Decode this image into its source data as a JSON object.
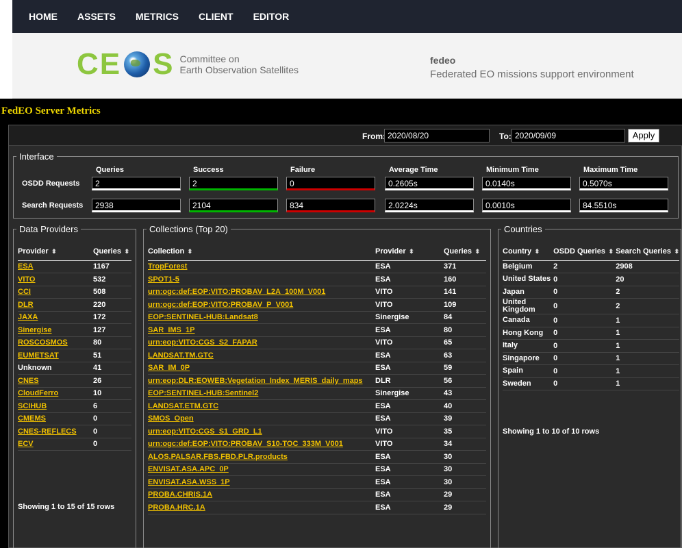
{
  "nav": [
    "HOME",
    "ASSETS",
    "METRICS",
    "CLIENT",
    "EDITOR"
  ],
  "banner": {
    "logo_text": "CEOS",
    "tagline_1": "Committee on",
    "tagline_2": "Earth Observation Satellites",
    "fedeo_name": "fedeo",
    "fedeo_desc": "Federated EO missions support environment"
  },
  "page_title": "FedEO Server Metrics",
  "dates": {
    "from_label": "From:",
    "from_value": "2020/08/20",
    "to_label": "To:",
    "to_value": "2020/09/09",
    "apply_label": "Apply"
  },
  "interface": {
    "legend": "Interface",
    "headers": [
      "Queries",
      "Success",
      "Failure",
      "Average Time",
      "Minimum Time",
      "Maximum Time"
    ],
    "rows": [
      {
        "label": "OSDD Requests",
        "values": [
          "2",
          "2",
          "0",
          "0.2605s",
          "0.0140s",
          "0.5070s"
        ]
      },
      {
        "label": "Search Requests",
        "values": [
          "2938",
          "2104",
          "834",
          "2.0224s",
          "0.0010s",
          "84.5510s"
        ]
      }
    ]
  },
  "providers": {
    "legend": "Data Providers",
    "headers": [
      "Provider",
      "Queries"
    ],
    "rows": [
      [
        "ESA",
        "1167",
        true
      ],
      [
        "VITO",
        "532",
        true
      ],
      [
        "CCI",
        "508",
        true
      ],
      [
        "DLR",
        "220",
        true
      ],
      [
        "JAXA",
        "172",
        true
      ],
      [
        "Sinergise",
        "127",
        true
      ],
      [
        "ROSCOSMOS",
        "80",
        true
      ],
      [
        "EUMETSAT",
        "51",
        true
      ],
      [
        "Unknown",
        "41",
        false
      ],
      [
        "CNES",
        "26",
        true
      ],
      [
        "CloudFerro",
        "10",
        true
      ],
      [
        "SCIHUB",
        "6",
        true
      ],
      [
        "CMEMS",
        "0",
        true
      ],
      [
        "CNES-REFLECS",
        "0",
        true
      ],
      [
        "ECV",
        "0",
        true
      ]
    ],
    "footer": "Showing 1 to 15 of 15 rows"
  },
  "collections": {
    "legend": "Collections (Top 20)",
    "headers": [
      "Collection",
      "Provider",
      "Queries"
    ],
    "rows": [
      [
        "TropForest",
        "ESA",
        "371"
      ],
      [
        "SPOT1-5",
        "ESA",
        "160"
      ],
      [
        "urn:ogc:def:EOP:VITO:PROBAV_L2A_100M_V001",
        "VITO",
        "141"
      ],
      [
        "urn:ogc:def:EOP:VITO:PROBAV_P_V001",
        "VITO",
        "109"
      ],
      [
        "EOP:SENTINEL-HUB:Landsat8",
        "Sinergise",
        "84"
      ],
      [
        "SAR_IMS_1P",
        "ESA",
        "80"
      ],
      [
        "urn:eop:VITO:CGS_S2_FAPAR",
        "VITO",
        "65"
      ],
      [
        "LANDSAT.TM.GTC",
        "ESA",
        "63"
      ],
      [
        "SAR_IM_0P",
        "ESA",
        "59"
      ],
      [
        "urn:eop:DLR:EOWEB:Vegetation_Index_MERIS_daily_maps",
        "DLR",
        "56"
      ],
      [
        "EOP:SENTINEL-HUB:Sentinel2",
        "Sinergise",
        "43"
      ],
      [
        "LANDSAT.ETM.GTC",
        "ESA",
        "40"
      ],
      [
        "SMOS_Open",
        "ESA",
        "39"
      ],
      [
        "urn:eop:VITO:CGS_S1_GRD_L1",
        "VITO",
        "35"
      ],
      [
        "urn:ogc:def:EOP:VITO:PROBAV_S10-TOC_333M_V001",
        "VITO",
        "34"
      ],
      [
        "ALOS.PALSAR.FBS.FBD.PLR.products",
        "ESA",
        "30"
      ],
      [
        "ENVISAT.ASA.APC_0P",
        "ESA",
        "30"
      ],
      [
        "ENVISAT.ASA.WSS_1P",
        "ESA",
        "30"
      ],
      [
        "PROBA.CHRIS.1A",
        "ESA",
        "29"
      ],
      [
        "PROBA.HRC.1A",
        "ESA",
        "29"
      ]
    ]
  },
  "countries": {
    "legend": "Countries",
    "headers": [
      "Country",
      "OSDD Queries",
      "Search Queries"
    ],
    "rows": [
      [
        "Belgium",
        "2",
        "2908"
      ],
      [
        "United States",
        "0",
        "20"
      ],
      [
        "Japan",
        "0",
        "2"
      ],
      [
        "United Kingdom",
        "0",
        "2"
      ],
      [
        "Canada",
        "0",
        "1"
      ],
      [
        "Hong Kong",
        "0",
        "1"
      ],
      [
        "Italy",
        "0",
        "1"
      ],
      [
        "Singapore",
        "0",
        "1"
      ],
      [
        "Spain",
        "0",
        "1"
      ],
      [
        "Sweden",
        "0",
        "1"
      ]
    ],
    "footer": "Showing 1 to 10 of 10 rows"
  },
  "colors": {
    "nav_bg": "#1f2430",
    "title_yellow": "#f0d800",
    "link_gold": "#f0c000",
    "success_green": "#00b400",
    "failure_red": "#cc0000",
    "ceos_green": "#8dc63f"
  },
  "icons": [
    "sort-icon",
    "globe-icon"
  ]
}
